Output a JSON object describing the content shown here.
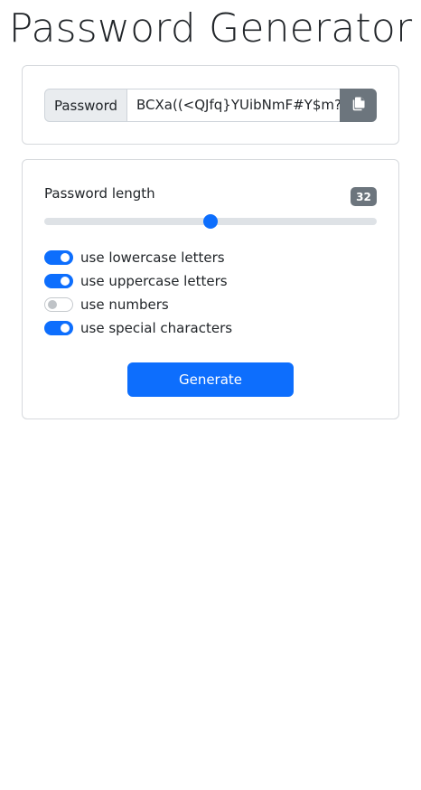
{
  "page": {
    "title": "Password Generator"
  },
  "output": {
    "label": "Password",
    "value": "BCXa((<QJfq}YUibNmF#Y$m?."
  },
  "settings": {
    "length_label": "Password length",
    "length_value": "32",
    "length_fraction": 0.5,
    "options": [
      {
        "label": "use lowercase letters",
        "checked": true
      },
      {
        "label": "use uppercase letters",
        "checked": true
      },
      {
        "label": "use numbers",
        "checked": false
      },
      {
        "label": "use special characters",
        "checked": true
      }
    ]
  },
  "actions": {
    "generate_label": "Generate"
  },
  "colors": {
    "primary": "#0d6efd",
    "secondary": "#6c757d"
  },
  "icons": {
    "copy": "copy-icon"
  }
}
